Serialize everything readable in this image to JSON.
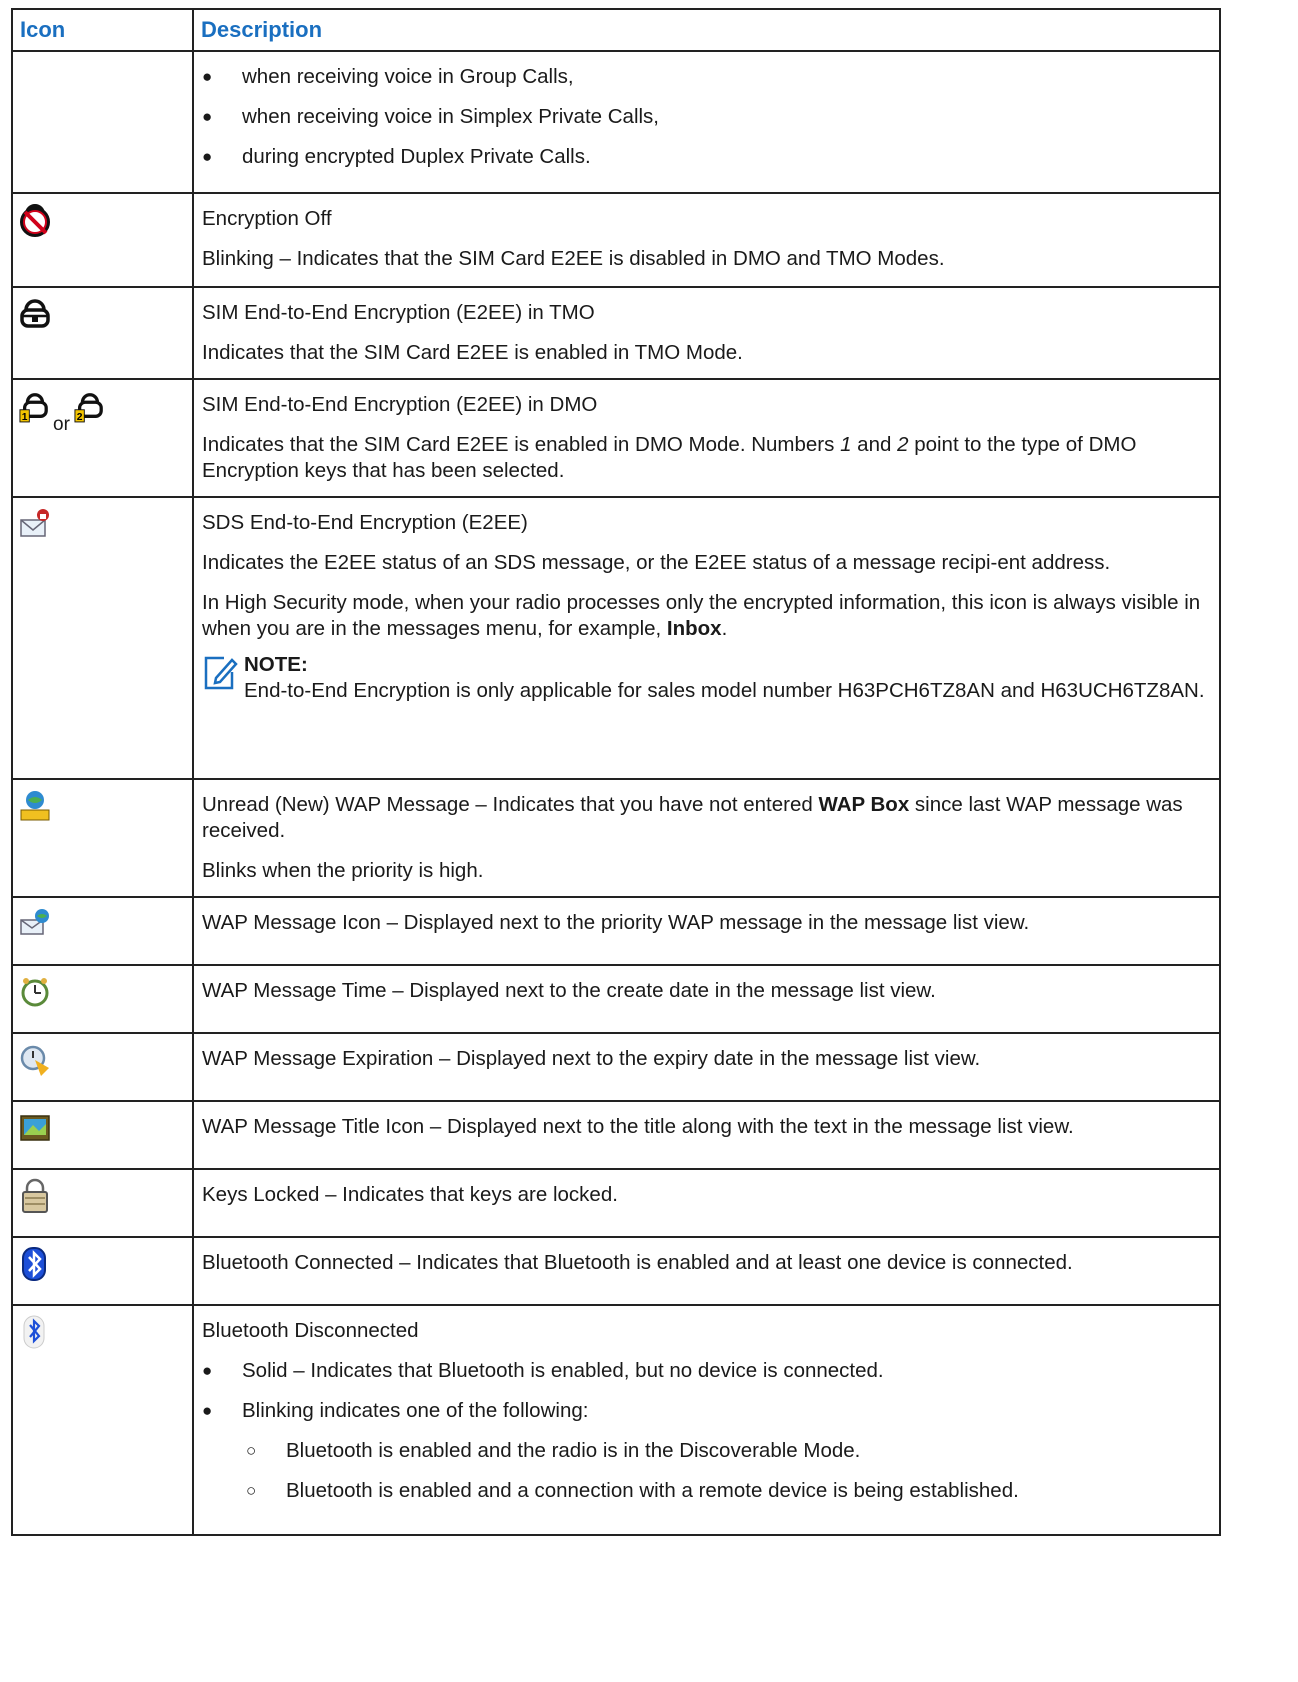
{
  "table": {
    "header": {
      "icon": "Icon",
      "description": "Description"
    },
    "row0": {
      "bullets": [
        "when receiving voice in Group Calls,",
        "when receiving voice in Simplex Private Calls,",
        "during encrypted Duplex Private Calls."
      ]
    },
    "row1": {
      "icon": "encryption-off-icon",
      "title": "Encryption Off",
      "text": "Blinking – Indicates that the SIM Card E2EE is disabled in DMO and TMO Modes."
    },
    "row2": {
      "icon": "sim-e2ee-tmo-icon",
      "title": "SIM End-to-End Encryption (E2EE) in TMO",
      "text": "Indicates that the SIM Card E2EE is enabled in TMO Mode."
    },
    "row3": {
      "icon": "sim-e2ee-dmo-icon",
      "or": "or",
      "title": "SIM End-to-End Encryption (E2EE) in DMO",
      "text_a": "Indicates that the SIM Card E2EE is enabled in DMO Mode. Numbers ",
      "n1": "1",
      "text_b": " and ",
      "n2": "2",
      "text_c": " point to the type of DMO Encryption keys that has been selected."
    },
    "row4": {
      "icon": "sds-e2ee-icon",
      "title": "SDS End-to-End Encryption (E2EE)",
      "text1": "Indicates the E2EE status of an SDS message, or the E2EE status of a message recipi-ent address.",
      "text2a": "In High Security mode, when your radio processes only the encrypted information, this icon is always visible in when you are in the messages menu, for example, ",
      "text2b": "Inbox",
      "text2c": ".",
      "note_title": "NOTE:",
      "note_text": "End-to-End Encryption is only applicable for sales model number H63PCH6TZ8AN and H63UCH6TZ8AN."
    },
    "row5": {
      "icon": "wap-unread-icon",
      "text_a": "Unread (New) WAP Message – Indicates that you have not entered ",
      "text_b": "WAP Box",
      "text_c": " since last WAP message was received.",
      "text2": "Blinks when the priority is high."
    },
    "row6": {
      "icon": "wap-message-icon",
      "text": "WAP Message Icon – Displayed next to the priority WAP message in the message list view."
    },
    "row7": {
      "icon": "wap-time-icon",
      "text": "WAP Message Time – Displayed next to the create date in the message list view."
    },
    "row8": {
      "icon": "wap-expiration-icon",
      "text": "WAP Message Expiration – Displayed next to the expiry date in the message list view."
    },
    "row9": {
      "icon": "wap-title-icon",
      "text": "WAP Message Title Icon – Displayed next to the title along with the text in the message list view."
    },
    "row10": {
      "icon": "keys-locked-icon",
      "text": "Keys Locked – Indicates that keys are locked."
    },
    "row11": {
      "icon": "bluetooth-connected-icon",
      "text": "Bluetooth Connected – Indicates that Bluetooth is enabled and at least one device is connected."
    },
    "row12": {
      "icon": "bluetooth-disconnected-icon",
      "title": "Bluetooth Disconnected",
      "b1": "Solid – Indicates that Bluetooth is enabled, but no device is connected.",
      "b2": "Blinking indicates one of the following:",
      "s1": "Bluetooth is enabled and the radio is in the Discoverable Mode.",
      "s2": "Bluetooth is enabled and a connection with a remote device is being established."
    }
  },
  "colors": {
    "header_text": "#1a6fc0",
    "border": "#222222"
  }
}
